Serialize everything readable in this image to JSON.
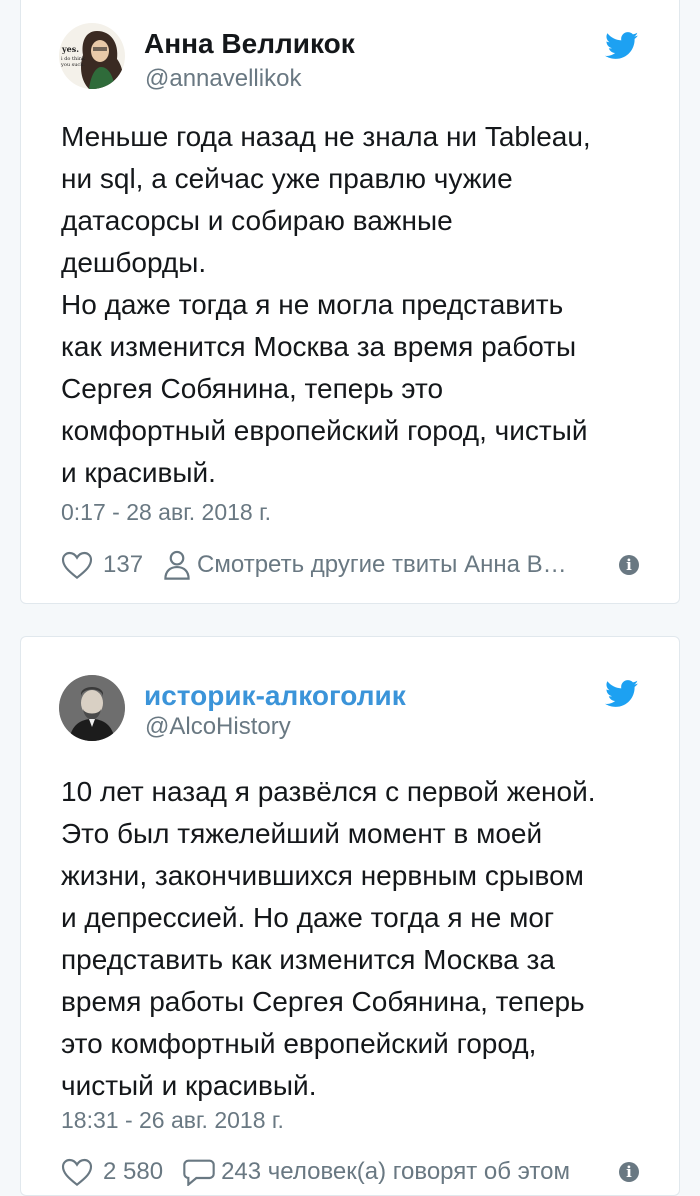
{
  "tweets": [
    {
      "author_name": "Анна Велликок",
      "author_handle": "@annavellikok",
      "avatar_text": [
        "yes.",
        "i do think",
        "you suck."
      ],
      "text_lines": [
        "Меньше года назад не знала ни Tableau,",
        "ни sql, а сейчас уже правлю чужие",
        "датасорсы и собираю важные",
        "дешборды.",
        "Но даже тогда я не могла представить",
        "как изменится Москва за время работы",
        "Сергея Собянина, теперь это",
        "комфортный европейский город, чистый",
        "и красивый."
      ],
      "timestamp": "0:17 - 28 авг. 2018 г.",
      "likes": "137",
      "more_tweets_label": "Смотреть другие твиты Анна В…"
    },
    {
      "author_name": "историк-алкоголик",
      "author_handle": "@AlcoHistory",
      "text_lines": [
        "10 лет назад я развёлся с первой женой.",
        "Это был тяжелейший момент в моей",
        "жизни, закончившихся нервным срывом",
        "и депрессией. Но даже тогда я не мог",
        "представить как изменится Москва за",
        "время работы Сергея Собянина, теперь",
        "это комфортный европейский город,",
        "чистый и красивый."
      ],
      "timestamp": "18:31 - 26 авг. 2018 г.",
      "likes": "2 580",
      "replies_label": "243 человек(а) говорят об этом"
    }
  ],
  "colors": {
    "background": "#f5f8fa",
    "card": "#ffffff",
    "text": "#14171a",
    "muted": "#697882",
    "link": "#3b94d9",
    "twitter_blue": "#1da1f2"
  },
  "icons": [
    "twitter-bird-icon",
    "heart-icon",
    "person-icon",
    "info-icon",
    "speech-bubble-icon"
  ]
}
